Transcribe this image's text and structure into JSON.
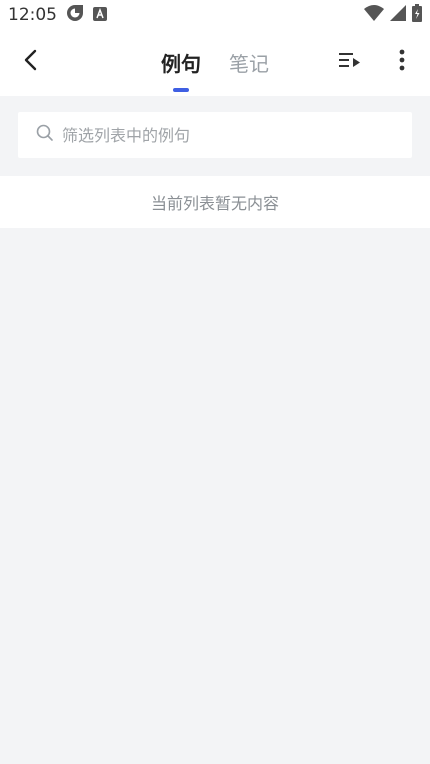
{
  "status_bar": {
    "time": "12:05"
  },
  "header": {
    "tabs": [
      {
        "label": "例句",
        "active": true
      },
      {
        "label": "笔记",
        "active": false
      }
    ]
  },
  "search": {
    "placeholder": "筛选列表中的例句",
    "value": ""
  },
  "list": {
    "empty_text": "当前列表暂无内容"
  },
  "icons": {
    "back": "chevron-left-icon",
    "queue": "playlist-play-icon",
    "more": "more-vertical-icon",
    "search": "search-icon"
  },
  "colors": {
    "accent": "#3f5fe3",
    "background": "#f3f4f6",
    "inactive_tab": "#9aa0a6"
  }
}
